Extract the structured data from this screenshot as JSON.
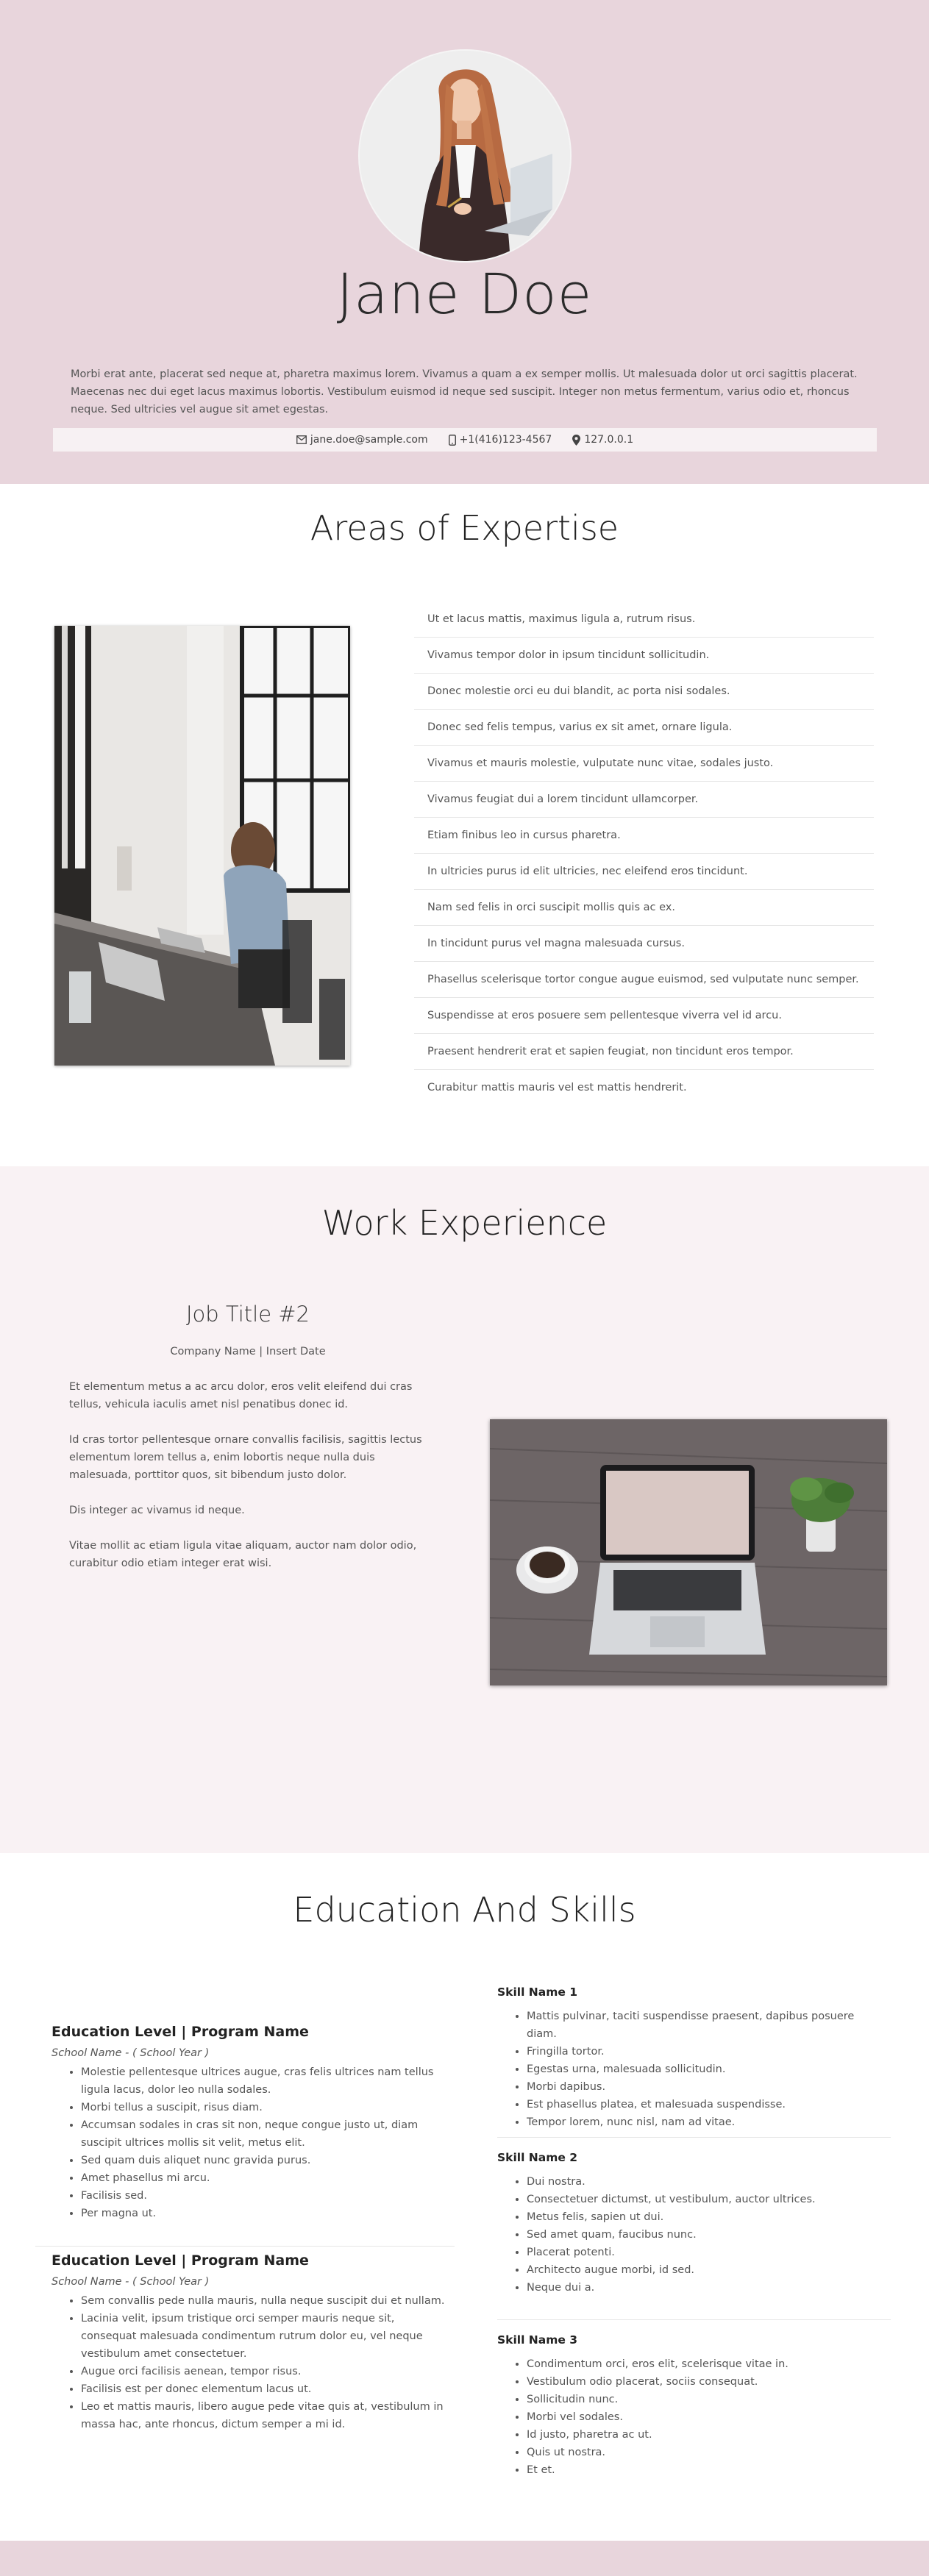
{
  "hero": {
    "name": "Jane Doe",
    "bio": "Morbi erat ante, placerat sed neque at, pharetra maximus lorem. Vivamus a quam a ex semper mollis. Ut malesuada dolor ut orci sagittis placerat. Maecenas nec dui eget lacus maximus lobortis. Vestibulum euismod id neque sed suscipit. Integer non metus fermentum, varius odio et, rhoncus neque. Sed ultricies vel augue sit amet egestas.",
    "contact": {
      "email": "jane.doe@sample.com",
      "phone": "+1(416)123-4567",
      "address": "127.0.0.1"
    }
  },
  "expertise": {
    "title": "Areas of Expertise",
    "items": [
      "Ut et lacus mattis, maximus ligula a, rutrum risus.",
      "Vivamus tempor dolor in ipsum tincidunt sollicitudin.",
      "Donec molestie orci eu dui blandit, ac porta nisi sodales.",
      "Donec sed felis tempus, varius ex sit amet, ornare ligula.",
      "Vivamus et mauris molestie, vulputate nunc vitae, sodales justo.",
      "Vivamus feugiat dui a lorem tincidunt ullamcorper.",
      "Etiam finibus leo in cursus pharetra.",
      "In ultricies purus id elit ultricies, nec eleifend eros tincidunt.",
      "Nam sed felis in orci suscipit mollis quis ac ex.",
      "In tincidunt purus vel magna malesuada cursus.",
      "Phasellus scelerisque tortor congue augue euismod, sed vulputate nunc semper.",
      "Suspendisse at eros posuere sem pellentesque viverra vel id arcu.",
      "Praesent hendrerit erat et sapien feugiat, non tincidunt eros tempor.",
      "Curabitur mattis mauris vel est mattis hendrerit."
    ]
  },
  "work": {
    "title": "Work Experience",
    "job_title": "Job Title #2",
    "company": "Company Name | Insert Date",
    "paragraphs": [
      "Et elementum metus a ac arcu dolor, eros velit eleifend dui cras tellus, vehicula iaculis amet nisl penatibus donec id.",
      "Id cras tortor pellentesque ornare convallis facilisis, sagittis lectus elementum lorem tellus a, enim lobortis neque nulla duis malesuada, porttitor quos, sit bibendum justo dolor.",
      "Dis integer ac vivamus id neque.",
      "Vitae mollit ac etiam ligula vitae aliquam, auctor nam dolor odio, curabitur odio etiam integer erat wisi."
    ]
  },
  "education": {
    "title": "Education And Skills",
    "entries": [
      {
        "level": "Education Level | Program Name",
        "school": "School Name - ( School Year )",
        "points": [
          "Molestie pellentesque ultrices augue, cras felis ultrices nam tellus ligula lacus, dolor leo nulla sodales.",
          "Morbi tellus a suscipit, risus diam.",
          "Accumsan sodales in cras sit non, neque congue justo ut, diam suscipit ultrices mollis sit velit, metus elit.",
          "Sed quam duis aliquet nunc gravida purus.",
          "Amet phasellus mi arcu.",
          "Facilisis sed.",
          "Per magna ut."
        ]
      },
      {
        "level": "Education Level | Program Name",
        "school": "School Name - ( School Year )",
        "points": [
          "Sem convallis pede nulla mauris, nulla neque suscipit dui et nullam.",
          "Lacinia velit, ipsum tristique orci semper mauris neque sit, consequat malesuada condimentum rutrum dolor eu, vel neque vestibulum amet consectetuer.",
          "Augue orci facilisis aenean, tempor risus.",
          "Facilisis est per donec elementum lacus ut.",
          "Leo et mattis mauris, libero augue pede vitae quis at, vestibulum in massa hac, ante rhoncus, dictum semper a mi id."
        ]
      }
    ],
    "skills": [
      {
        "name": "Skill Name 1",
        "items": [
          "Mattis pulvinar, taciti suspendisse praesent, dapibus posuere diam.",
          "Fringilla tortor.",
          "Egestas urna, malesuada sollicitudin.",
          "Morbi dapibus.",
          "Est phasellus platea, et malesuada suspendisse.",
          "Tempor lorem, nunc nisl, nam ad vitae."
        ]
      },
      {
        "name": "Skill Name 2",
        "items": [
          "Dui nostra.",
          "Consectetuer dictumst, ut vestibulum, auctor ultrices.",
          "Metus felis, sapien ut dui.",
          "Sed amet quam, faucibus nunc.",
          "Placerat potenti.",
          "Architecto augue morbi, id sed.",
          "Neque dui a."
        ]
      },
      {
        "name": "Skill Name 3",
        "items": [
          "Condimentum orci, eros elit, scelerisque vitae in.",
          "Vestibulum odio placerat, sociis consequat.",
          "Sollicitudin nunc.",
          "Morbi vel sodales.",
          "Id justo, pharetra ac ut.",
          "Quis ut nostra.",
          "Et et."
        ]
      }
    ]
  },
  "colors": {
    "hero_bg": "#e8d5dc",
    "work_bg": "#f9f2f4",
    "contact_bar_bg": "#f7f1f3"
  },
  "icons": [
    "envelope-icon",
    "mobile-phone-icon",
    "map-marker-icon"
  ]
}
